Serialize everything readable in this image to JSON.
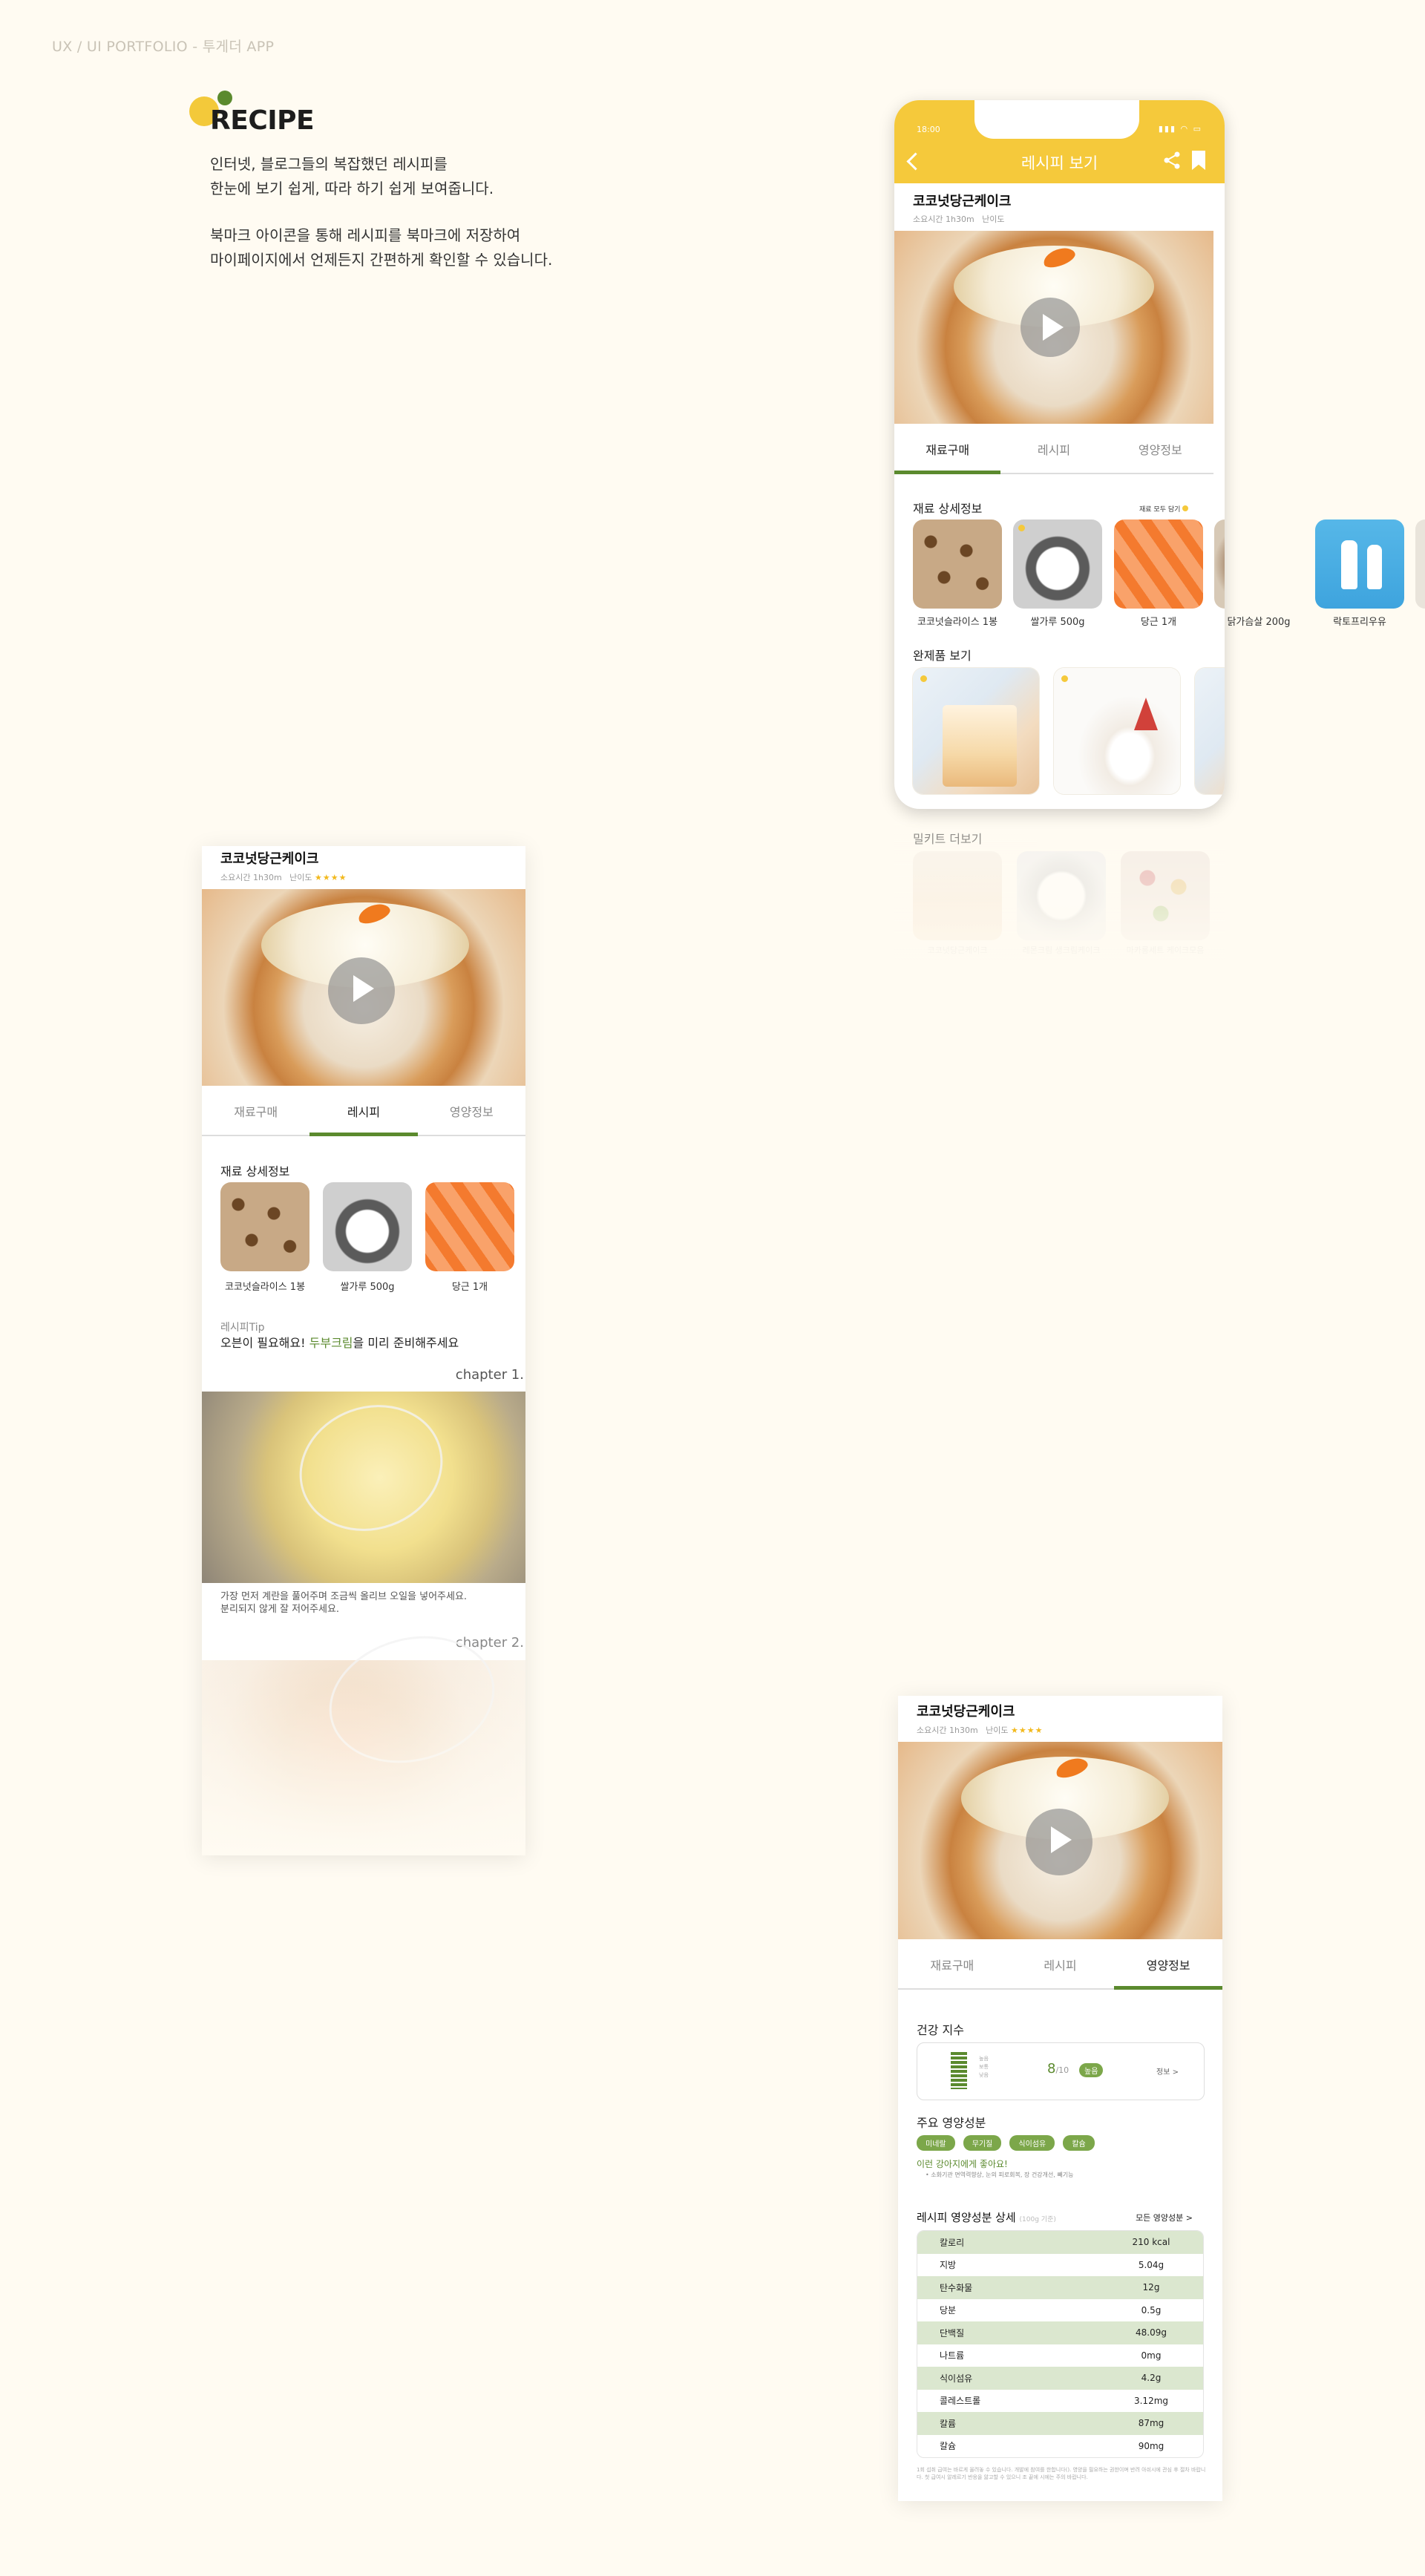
{
  "header": {
    "portfolio_label": "UX / UI PORTFOLIO - 투게더 APP",
    "logo_text": "RECIPE",
    "intro_lines": [
      "인터넷, 블로그들의 복잡했던 레시피를",
      "한눈에 보기 쉽게, 따라 하기 쉽게 보여줍니다.",
      "북마크 아이콘을 통해 레시피를 북마크에 저장하여",
      "마이페이지에서 언제든지 간편하게 확인할 수 있습니다."
    ]
  },
  "colors": {
    "accent_yellow": "#f5c93b",
    "accent_green": "#5b8a2e",
    "background": "#fffbf2"
  },
  "phone": {
    "status_time": "18:00",
    "appbar_title": "레시피 보기",
    "icons": [
      "back-icon",
      "share-icon",
      "bookmark-icon"
    ]
  },
  "recipe": {
    "title": "코코넛당근케이크",
    "time_label": "소요시간",
    "time_value": "1h30m",
    "difficulty_label": "난이도",
    "difficulty_stars": "★★★★"
  },
  "tabs": [
    "재료구매",
    "레시피",
    "영양정보"
  ],
  "screen1": {
    "ingredients_heading": "재료 상세정보",
    "select_all_label": "재료 모두 담기",
    "ingredients": [
      "코코넛슬라이스 1봉",
      "쌀가루 500g",
      "당근 1개",
      "닭가슴살 200g",
      "락토프리우유"
    ],
    "products_heading": "완제품 보기",
    "mealkit_heading": "밀키트 더보기",
    "mealkit_labels": [
      "코코넛당근케이크",
      "레몬크림 생크림케이크",
      "마카롱세트 케이크모음"
    ]
  },
  "screen2": {
    "ingredients_heading": "재료 상세정보",
    "ingredients": [
      "코코넛슬라이스 1봉",
      "쌀가루 500g",
      "당근 1개"
    ],
    "tip_label": "레시피Tip",
    "tip_prefix": "오븐이 필요해요! ",
    "tip_highlight": "두부크림",
    "tip_suffix": "을 미리 준비해주세요",
    "chapter1": "chapter 1.",
    "step1_lines": [
      "가장 먼저 계란을 풀어주며 조금씩 올리브 오일을 넣어주세요.",
      "분리되지 않게 잘 저어주세요."
    ],
    "chapter2": "chapter 2."
  },
  "screen3": {
    "health_heading": "건강 지수",
    "health_score": "8",
    "health_score_unit": "/10",
    "health_badge": "높음",
    "gauge_levels": [
      "높음",
      "보통",
      "낮음"
    ],
    "health_info_link": "정보 >",
    "main_nutrients_heading": "주요 영양성분",
    "nutrient_badges": [
      "미네랄",
      "무기질",
      "식이섬유",
      "칼슘"
    ],
    "recommend": "이런 강아지에게 좋아요!",
    "recommend_detail": "• 소화기관 면역력향상, 눈의 피로회복, 장 건강개선, 빼기능",
    "detail_heading": "레시피 영양성분 상세",
    "detail_sub": "(100g 기준)",
    "detail_link": "모든 영양성분 >",
    "nutrition_table": [
      [
        "칼로리",
        "210 kcal"
      ],
      [
        "지방",
        "5.04g"
      ],
      [
        "탄수화물",
        "12g"
      ],
      [
        "당분",
        "0.5g"
      ],
      [
        "단백질",
        "48.09g"
      ],
      [
        "나트륨",
        "0mg"
      ],
      [
        "식이섬유",
        "4.2g"
      ],
      [
        "콜레스트롤",
        "3.12mg"
      ],
      [
        "칼륨",
        "87mg"
      ],
      [
        "칼슘",
        "90mg"
      ]
    ],
    "footnote": "1회 섭취 급여는 바르게 올려놓 수 있습니다. 개발에 참여를 한합니다(). 영양을 필요하는 권한이며 반려 아쉬시에 관심 후 절차 바랍니다. 첫 급여시 알레르기 반응을 앓고할 수 있으니 조 끝에 시에는 주의 바랍니다."
  }
}
